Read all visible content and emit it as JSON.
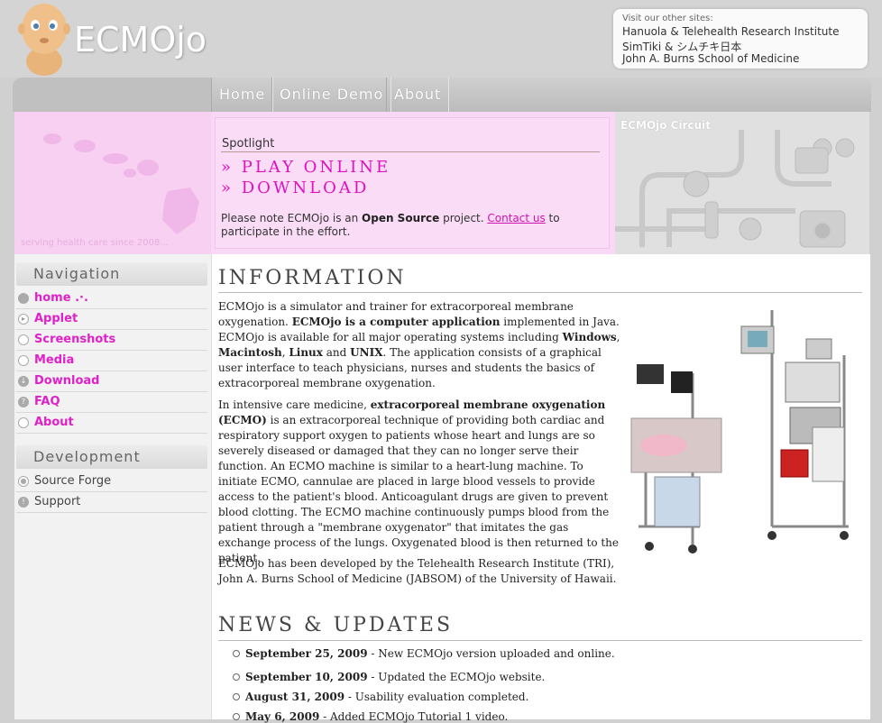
{
  "header": {
    "logo_text": "ECMOjo",
    "other_sites": {
      "heading": "Visit our other sites:",
      "lines": [
        "Hanuola  &  Telehealth Research Institute",
        "SimTiki  &  シムチキ日本",
        "John A. Burns School of Medicine"
      ]
    }
  },
  "tabs": [
    "Home",
    "Online Demo",
    "About"
  ],
  "spotlight": {
    "tagline": "serving health care since 2008...",
    "title": "Spotlight",
    "links": [
      "» PLAY ONLINE",
      "» DOWNLOAD"
    ],
    "note_prefix": "Please note ECMOjo is an ",
    "note_bold": "Open Source",
    "note_mid": " project. ",
    "note_link": "Contact us",
    "note_suffix": " to participate in the effort.",
    "circuit_caption": "ECMOjo Circuit"
  },
  "sidebar": {
    "nav_heading": "Navigation",
    "nav_items": [
      "home .·.",
      "Applet",
      "Screenshots",
      "Media",
      "Download",
      "FAQ",
      "About"
    ],
    "dev_heading": "Development",
    "dev_items": [
      "Source Forge",
      "Support"
    ]
  },
  "info": {
    "title": "INFORMATION",
    "p1": {
      "a": "ECMOjo is a simulator and trainer for extracorporeal membrane oxygenation. ",
      "b": "ECMOjo is a computer application",
      "c": " implemented in Java. ECMOjo is available for all major operating systems including ",
      "d": "Windows",
      "e": ", ",
      "f": "Macintosh",
      "g": ", ",
      "h": "Linux",
      "i": " and ",
      "j": "UNIX",
      "k": ". The application consists of a graphical user interface to teach physicians, nurses and students the basics of extracorporeal membrane oxygenation."
    },
    "p2": {
      "a": "In intensive care medicine, ",
      "b": "extracorporeal membrane oxygenation (ECMO)",
      "c": " is an extracorporeal technique of providing both cardiac and respiratory support oxygen to patients whose heart and lungs are so severely diseased or damaged that they can no longer serve their function. An ECMO machine is similar to a heart-lung machine. To initiate ECMO, cannulae are placed in large blood vessels to provide access to the patient's blood. Anticoagulant drugs are given to prevent blood clotting. The ECMO machine continuously pumps blood from the patient through a \"membrane oxygenator\" that imitates the gas exchange process of the lungs. Oxygenated blood is then returned to the patient."
    },
    "p3": "ECMOjo has been developed by the Telehealth Research Institute (TRI), John A. Burns School of Medicine (JABSOM) of the University of Hawaii."
  },
  "news": {
    "title": "NEWS & UPDATES",
    "items": [
      {
        "date": "September 25, 2009",
        "text": " - New ECMOjo version uploaded and online."
      },
      {
        "date": "September 10, 2009",
        "text": " - Updated the ECMOjo website."
      },
      {
        "date": "August 31, 2009",
        "text": " - Usability evaluation completed."
      },
      {
        "date": "May 6, 2009",
        "text": " - Added ECMOjo Tutorial 1 video."
      }
    ]
  }
}
